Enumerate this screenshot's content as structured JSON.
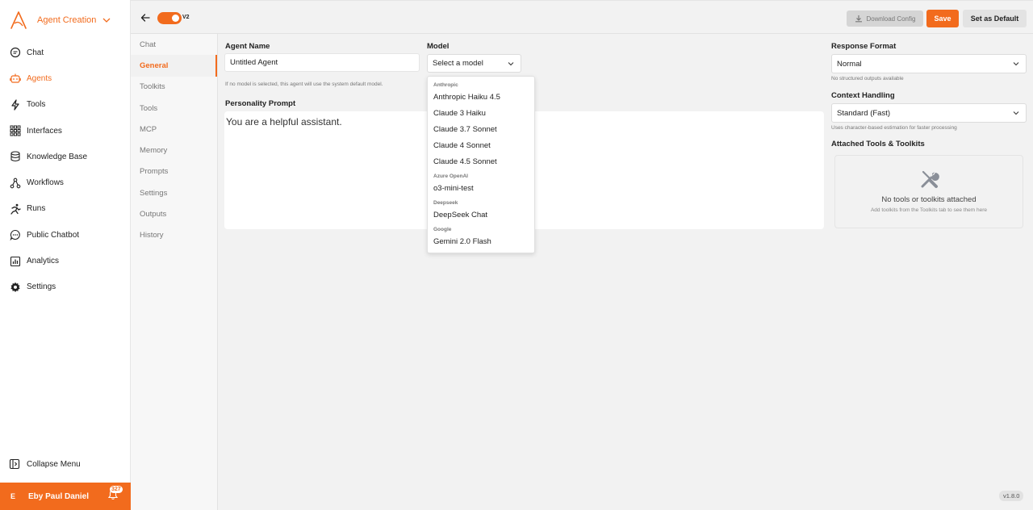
{
  "sidebar": {
    "brand_title": "Agent Creation",
    "items": [
      {
        "label": "Chat",
        "icon": "chat-bubble-icon"
      },
      {
        "label": "Agents",
        "icon": "robot-icon"
      },
      {
        "label": "Tools",
        "icon": "lightning-icon"
      },
      {
        "label": "Interfaces",
        "icon": "grid-icon"
      },
      {
        "label": "Knowledge Base",
        "icon": "database-icon"
      },
      {
        "label": "Workflows",
        "icon": "workflow-icon"
      },
      {
        "label": "Runs",
        "icon": "running-person-icon"
      },
      {
        "label": "Public Chatbot",
        "icon": "chat-dots-icon"
      },
      {
        "label": "Analytics",
        "icon": "bar-chart-icon"
      },
      {
        "label": "Settings",
        "icon": "gear-icon"
      }
    ],
    "active_item": "Agents",
    "collapse_label": "Collapse Menu",
    "user": {
      "initial": "E",
      "name": "Eby Paul Daniel",
      "notifications": "327"
    }
  },
  "topbar": {
    "toggle_label": "V2",
    "download_label": "Download Config",
    "save_label": "Save",
    "default_label": "Set as Default"
  },
  "subnav": {
    "items": [
      "Chat",
      "General",
      "Toolkits",
      "Tools",
      "MCP",
      "Memory",
      "Prompts",
      "Settings",
      "Outputs",
      "History"
    ],
    "active": "General"
  },
  "form": {
    "agent_name_label": "Agent Name",
    "agent_name_value": "Untitled Agent",
    "model_hint": "If no model is selected, this agent will use the system default model.",
    "model_label": "Model",
    "model_placeholder": "Select a model",
    "prompt_label": "Personality Prompt",
    "prompt_value": "You are a helpful assistant.",
    "response_format_label": "Response Format",
    "response_format_value": "Normal",
    "response_format_hint": "No structured outputs available",
    "context_label": "Context Handling",
    "context_value": "Standard (Fast)",
    "context_hint": "Uses character-based estimation for faster processing",
    "attached_label": "Attached Tools & Toolkits",
    "attached_empty_title": "No tools or toolkits attached",
    "attached_empty_sub": "Add toolkits from the Toolkits tab to see them here"
  },
  "model_dropdown": {
    "groups": [
      {
        "name": "Anthropic",
        "items": [
          "Anthropic Haiku 4.5",
          "Claude 3 Haiku",
          "Claude 3.7 Sonnet",
          "Claude 4 Sonnet",
          "Claude 4.5 Sonnet"
        ]
      },
      {
        "name": "Azure OpenAI",
        "items": [
          "o3-mini-test"
        ]
      },
      {
        "name": "Deepseek",
        "items": [
          "DeepSeek Chat"
        ]
      },
      {
        "name": "Google",
        "items": [
          "Gemini 2.0 Flash"
        ]
      }
    ]
  },
  "version": "v1.8.0",
  "colors": {
    "accent": "#f26b1d"
  }
}
